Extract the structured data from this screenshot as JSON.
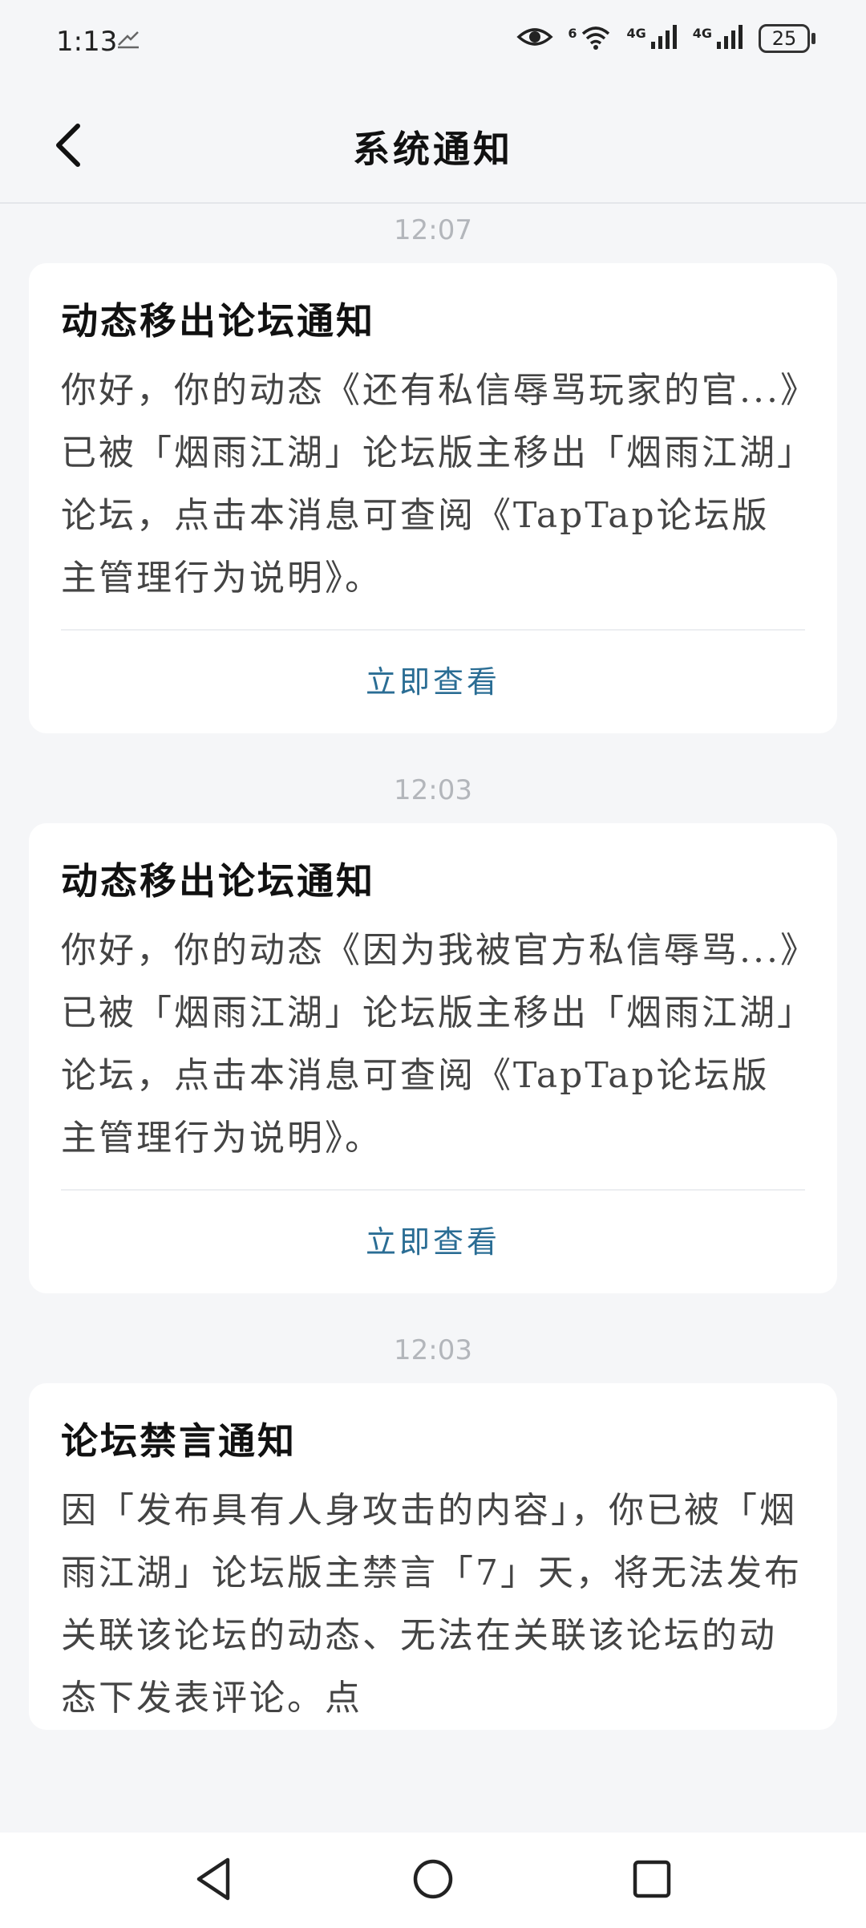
{
  "status_bar": {
    "time": "1:13",
    "battery": "25",
    "network_1": "4G",
    "network_2": "4G",
    "wifi_label": "6"
  },
  "header": {
    "title": "系统通知"
  },
  "notifications": [
    {
      "time": "12:07",
      "title": "动态移出论坛通知",
      "body": "你好，你的动态《还有私信辱骂玩家的官...》已被「烟雨江湖」论坛版主移出「烟雨江湖」论坛，点击本消息可查阅《TapTap论坛版主管理行为说明》。",
      "action": "立即查看"
    },
    {
      "time": "12:03",
      "title": "动态移出论坛通知",
      "body": "你好，你的动态《因为我被官方私信辱骂...》已被「烟雨江湖」论坛版主移出「烟雨江湖」论坛，点击本消息可查阅《TapTap论坛版主管理行为说明》。",
      "action": "立即查看"
    },
    {
      "time": "12:03",
      "title": "论坛禁言通知",
      "body": "因「发布具有人身攻击的内容」，你已被「烟雨江湖」论坛版主禁言「7」天，将无法发布关联该论坛的动态、无法在关联该论坛的动态下发表评论。点",
      "action": ""
    }
  ]
}
